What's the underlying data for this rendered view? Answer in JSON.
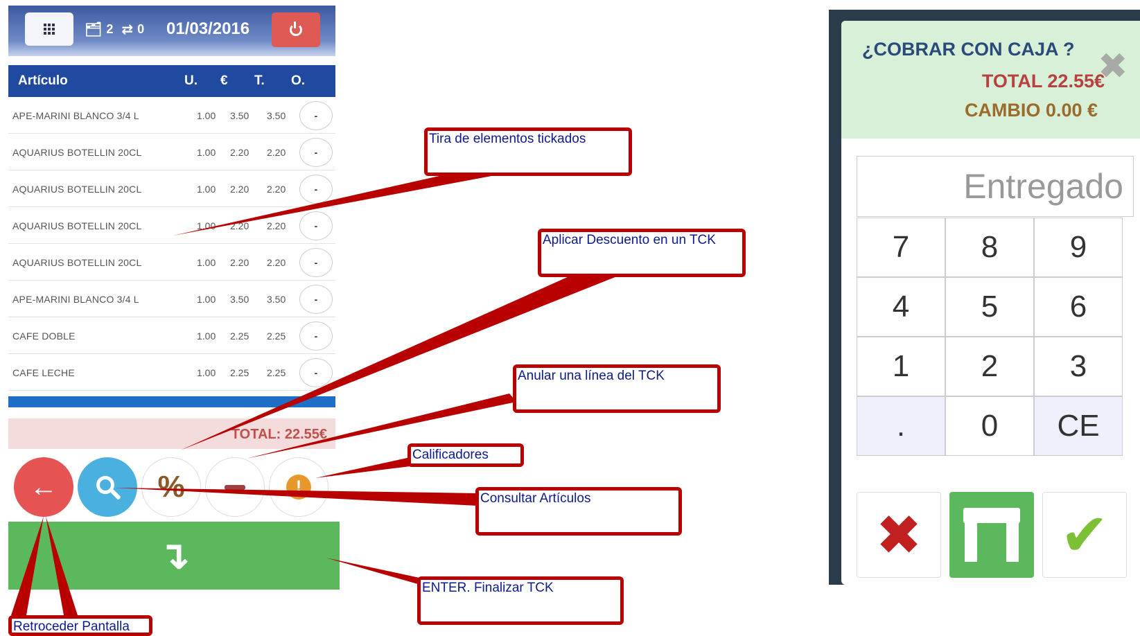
{
  "topbar": {
    "badge_docs": "2",
    "badge_transfers": "0",
    "date": "01/03/2016"
  },
  "ticket": {
    "headers": {
      "article": "Artículo",
      "units": "U.",
      "price": "€",
      "total": "T.",
      "options": "O."
    },
    "rows": [
      {
        "name": "APE-MARINI BLANCO 3/4 L",
        "u": "1.00",
        "p": "3.50",
        "t": "3.50",
        "o": "-"
      },
      {
        "name": "AQUARIUS BOTELLIN 20CL",
        "u": "1.00",
        "p": "2.20",
        "t": "2.20",
        "o": "-"
      },
      {
        "name": "AQUARIUS BOTELLIN 20CL",
        "u": "1.00",
        "p": "2.20",
        "t": "2.20",
        "o": "-"
      },
      {
        "name": "AQUARIUS BOTELLIN 20CL",
        "u": "1.00",
        "p": "2.20",
        "t": "2.20",
        "o": "-"
      },
      {
        "name": "AQUARIUS BOTELLIN 20CL",
        "u": "1.00",
        "p": "2.20",
        "t": "2.20",
        "o": "-"
      },
      {
        "name": "APE-MARINI BLANCO 3/4 L",
        "u": "1.00",
        "p": "3.50",
        "t": "3.50",
        "o": "-"
      },
      {
        "name": "CAFE DOBLE",
        "u": "1.00",
        "p": "2.25",
        "t": "2.25",
        "o": "-"
      },
      {
        "name": "CAFE LECHE",
        "u": "1.00",
        "p": "2.25",
        "t": "2.25",
        "o": "-"
      }
    ],
    "total_label": "TOTAL: 22.55€"
  },
  "actions": {
    "discount_symbol": "%",
    "qualifier_symbol": "!"
  },
  "dialog": {
    "title": "¿COBRAR CON CAJA ?",
    "total": "TOTAL 22.55€",
    "change": "CAMBIO 0.00 €",
    "entregado_placeholder": "Entregado",
    "keys": [
      "7",
      "8",
      "9",
      "4",
      "5",
      "6",
      "1",
      "2",
      "3",
      ".",
      "0",
      "CE"
    ]
  },
  "annotations": {
    "tira": "Tira de elementos tickados",
    "descuento": "Aplicar Descuento en un TCK",
    "anular": "Anular una línea del TCK",
    "calificadores": "Calificadores",
    "consultar": "Consultar Artículos",
    "enter": "ENTER. Finalizar TCK",
    "retroceder": "Retroceder Pantalla"
  },
  "colors": {
    "topbar_blue": "#3c5aa0",
    "header_blue": "#1f4aa0",
    "enter_green": "#5cb85c",
    "power_red": "#e05a55",
    "total_red": "#c0504d",
    "annotation_red": "#b80000",
    "annotation_text": "#0c1a8c"
  },
  "icons": {
    "grid": "grid-icon",
    "docs": "tray-icon",
    "transfers": "transfer-icon",
    "power": "power-icon",
    "back": "arrow-left-icon",
    "search": "search-icon",
    "discount": "percent-icon",
    "void": "minus-icon",
    "qualifier": "exclamation-icon",
    "enter": "enter-arrow-icon",
    "cancel": "x-icon",
    "table": "table-icon",
    "confirm": "check-icon",
    "close": "close-icon"
  }
}
